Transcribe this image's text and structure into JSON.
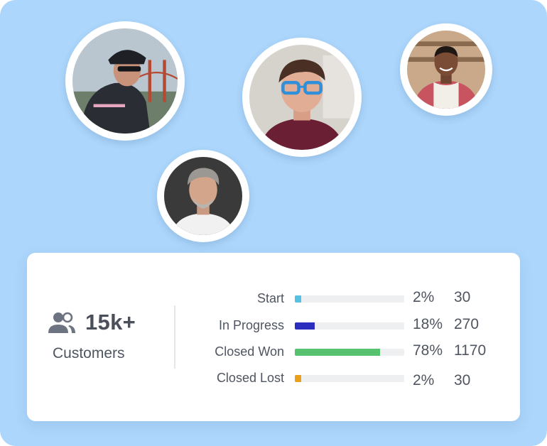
{
  "avatars": [
    {
      "name": "cyclist",
      "ring": "#ffffff"
    },
    {
      "name": "man-with-blue-glasses",
      "ring": "#ffffff"
    },
    {
      "name": "man-in-apron",
      "ring": "#ffffff"
    },
    {
      "name": "grey-haired-man",
      "ring": "#ffffff"
    }
  ],
  "summary": {
    "icon": "people-icon",
    "count": "15k+",
    "label": "Customers"
  },
  "pipeline": [
    {
      "label": "Start",
      "percent_text": "2%",
      "percent": 2,
      "value": "30",
      "color": "#55c2e4"
    },
    {
      "label": "In Progress",
      "percent_text": "18%",
      "percent": 18,
      "value": "270",
      "color": "#2b2dbf"
    },
    {
      "label": "Closed Won",
      "percent_text": "78%",
      "percent": 78,
      "value": "1170",
      "color": "#56c26f"
    },
    {
      "label": "Closed Lost",
      "percent_text": "2%",
      "percent": 2,
      "value": "30",
      "color": "#e9a11c"
    }
  ],
  "colors": {
    "background": "#acd6fb",
    "card": "#ffffff",
    "text": "#4f5560",
    "track": "#eeeff1"
  }
}
